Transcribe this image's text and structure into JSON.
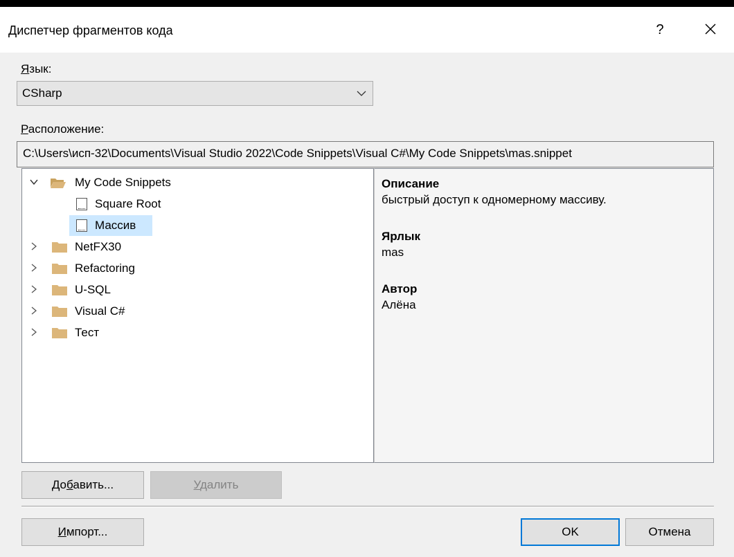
{
  "dialog": {
    "title": "Диспетчер фрагментов кода",
    "help_label": "?"
  },
  "language": {
    "label_accel": "Я",
    "label_rest": "зык:",
    "selected": "CSharp"
  },
  "location": {
    "label_accel": "Р",
    "label_rest": "асположение:",
    "path": "C:\\Users\\исп-32\\Documents\\Visual Studio 2022\\Code Snippets\\Visual C#\\My Code Snippets\\mas.snippet"
  },
  "tree": {
    "root": {
      "label": "My Code Snippets",
      "expanded": true
    },
    "snippets": [
      {
        "label": "Square Root"
      },
      {
        "label": "Массив",
        "selected": true
      }
    ],
    "folders": [
      {
        "label": "NetFX30"
      },
      {
        "label": "Refactoring"
      },
      {
        "label": "U-SQL"
      },
      {
        "label": "Visual C#"
      },
      {
        "label": "Тест"
      }
    ]
  },
  "details": {
    "description_header": "Описание",
    "description": "быстрый доступ к одномерному массиву.",
    "shortcut_header": "Ярлык",
    "shortcut": "mas",
    "author_header": "Автор",
    "author": "Алёна"
  },
  "buttons": {
    "add_pre": "До",
    "add_accel": "б",
    "add_post": "авить...",
    "remove_accel": "У",
    "remove_post": "далить",
    "import_accel": "И",
    "import_post": "мпорт...",
    "ok": "OK",
    "cancel": "Отмена"
  },
  "colors": {
    "selection": "#cce8ff",
    "default_button_border": "#0078d7",
    "folder": "#dcb67a"
  }
}
